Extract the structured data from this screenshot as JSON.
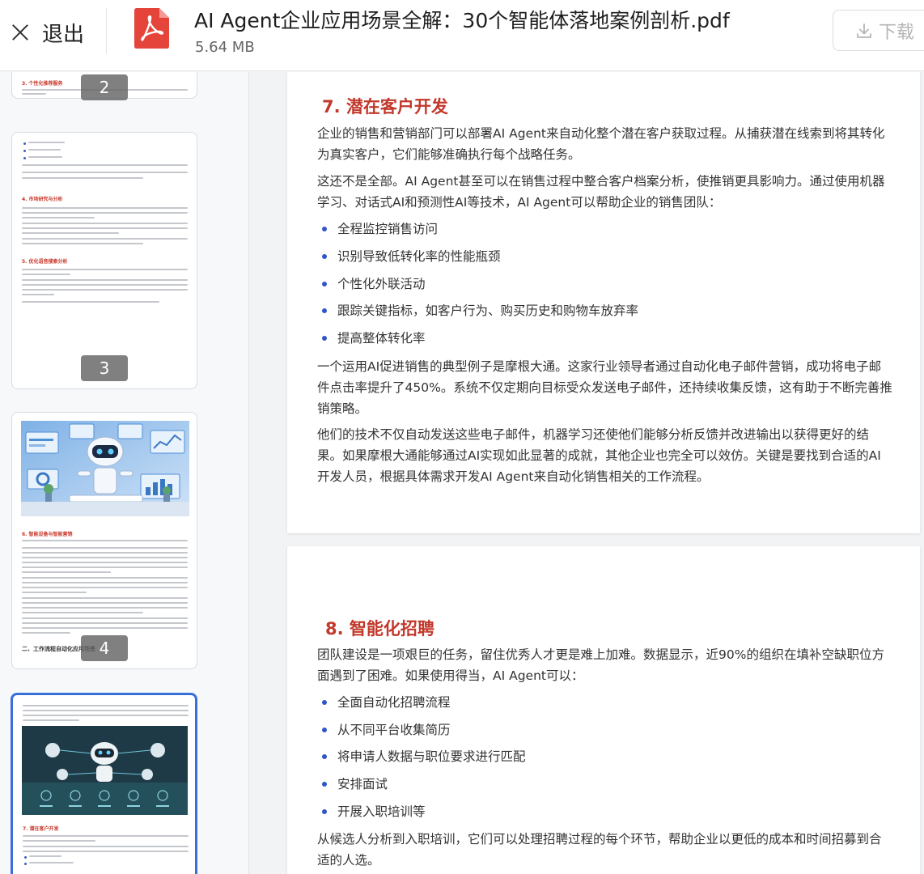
{
  "header": {
    "exit_label": "退出",
    "file_name": "AI Agent企业应用场景全解：30个智能体落地案例剖析.pdf",
    "file_size": "5.64 MB",
    "download_label": "下载"
  },
  "sidebar": {
    "pages": [
      "2",
      "3",
      "4",
      ""
    ],
    "active_page_index": 3,
    "thumb2_heading": "3. 个性化推荐服务",
    "thumb3_heading_1": "4. 市场研究与分析",
    "thumb3_heading_2": "5. 优化语音搜索分析",
    "thumb4_heading": "6. 智能设备与智能营销",
    "thumb4_section": "二、工作流程自动化应用场景",
    "thumb5_heading": "7. 潜在客户开发"
  },
  "content": {
    "sections": [
      {
        "heading": "7. 潜在客户开发",
        "paragraphs_before": [
          "企业的销售和营销部门可以部署AI Agent来自动化整个潜在客户获取过程。从捕获潜在线索到将其转化为真实客户，它们能够准确执行每个战略任务。",
          "这还不是全部。AI Agent甚至可以在销售过程中整合客户档案分析，使推销更具影响力。通过使用机器学习、对话式AI和预测性AI等技术，AI Agent可以帮助企业的销售团队："
        ],
        "bullets": [
          "全程监控销售访问",
          "识别导致低转化率的性能瓶颈",
          "个性化外联活动",
          "跟踪关键指标，如客户行为、购买历史和购物车放弃率",
          "提高整体转化率"
        ],
        "paragraphs_after": [
          "一个运用AI促进销售的典型例子是摩根大通。这家行业领导者通过自动化电子邮件营销，成功将电子邮件点击率提升了450%。系统不仅定期向目标受众发送电子邮件，还持续收集反馈，这有助于不断完善推销策略。",
          "他们的技术不仅自动发送这些电子邮件，机器学习还使他们能够分析反馈并改进输出以获得更好的结果。如果摩根大通能够通过AI实现如此显著的成就，其他企业也完全可以效仿。关键是要找到合适的AI开发人员，根据具体需求开发AI Agent来自动化销售相关的工作流程。"
        ]
      },
      {
        "heading": "8. 智能化招聘",
        "paragraphs_before": [
          "团队建设是一项艰巨的任务，留住优秀人才更是难上加难。数据显示，近90%的组织在填补空缺职位方面遇到了困难。如果使用得当，AI Agent可以："
        ],
        "bullets": [
          "全面自动化招聘流程",
          "从不同平台收集简历",
          "将申请人数据与职位要求进行匹配",
          "安排面试",
          "开展入职培训等"
        ],
        "paragraphs_after": [
          "从候选人分析到入职培训，它们可以处理招聘过程的每个环节，帮助企业以更低的成本和时间招募到合适的人选。"
        ]
      }
    ]
  },
  "colors": {
    "heading_red": "#c2382b",
    "bullet_blue": "#2f56c9",
    "active_thumb_border": "#3a6fd8"
  }
}
